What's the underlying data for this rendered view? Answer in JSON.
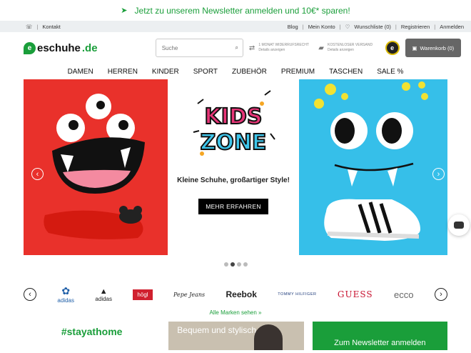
{
  "promo": {
    "text": "Jetzt zu unserem Newsletter anmelden und 10€* sparen!",
    "icon": "paper-plane-icon"
  },
  "topbar": {
    "contact": "Kontakt",
    "links": [
      "Blog",
      "Mein Konto",
      "Wunschliste (0)",
      "Registrieren",
      "Anmelden"
    ]
  },
  "header": {
    "logo_main": "eschuhe",
    "logo_tld": ".de",
    "search_placeholder": "Suche",
    "usp1_title": "1 MONAT WIDERRUFSRECHT",
    "usp1_sub": "Details anzeigen",
    "usp2_title": "KOSTENLOSER VERSAND",
    "usp2_sub": "Details anzeigen",
    "trust_badge": "e",
    "cart_label": "Warenkorb (0)"
  },
  "nav": [
    "DAMEN",
    "HERREN",
    "KINDER",
    "SPORT",
    "ZUBEHÖR",
    "PREMIUM",
    "TASCHEN",
    "SALE %"
  ],
  "hero": {
    "kids_line1": "KIDS",
    "kids_line2": "ZONE",
    "tagline": "Kleine Schuhe, großartiger Style!",
    "button": "MEHR ERFAHREN",
    "slides": 4,
    "active_slide": 2
  },
  "brands": {
    "items": [
      "adidas",
      "adidas",
      "högl",
      "Pepe Jeans",
      "Reebok",
      "TOMMY HILFIGER",
      "GUESS",
      "ecco"
    ],
    "all_link": "Alle Marken sehen »"
  },
  "bottom": {
    "stay": "#stayathome",
    "tile1": "Bequem und stylisch",
    "tile2": "Zum Newsletter anmelden"
  },
  "colors": {
    "brand_green": "#1a9e3a",
    "hero_red": "#e9312b",
    "hero_blue": "#36bfe9"
  }
}
